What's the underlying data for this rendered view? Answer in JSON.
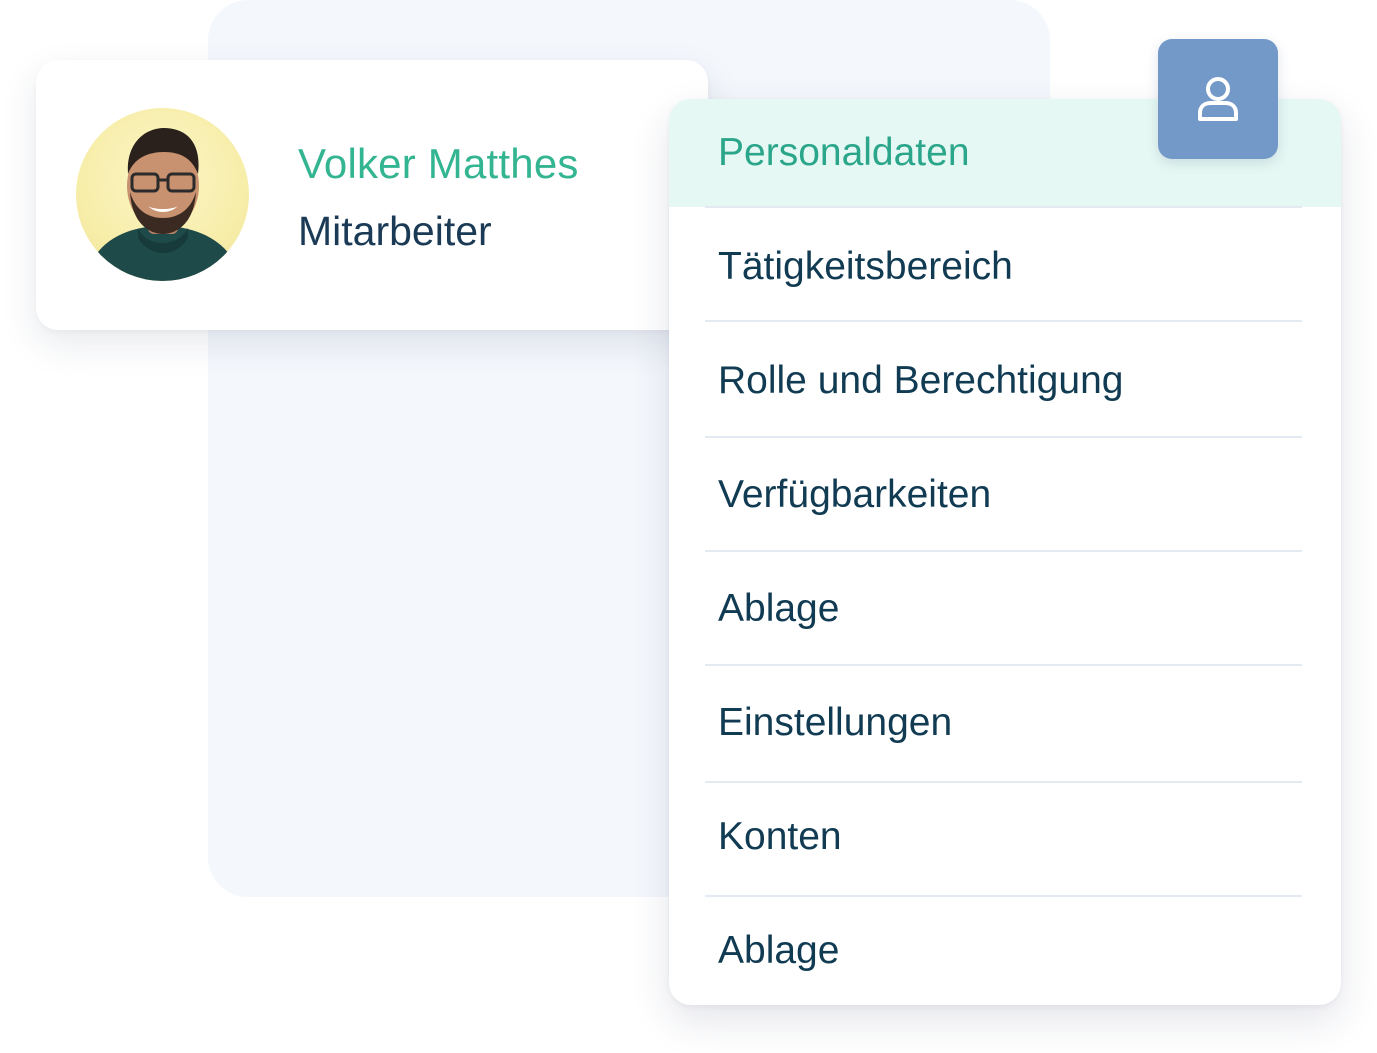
{
  "profile": {
    "name": "Volker Matthes",
    "role": "Mitarbeiter"
  },
  "user_button": {
    "icon": "user-icon"
  },
  "menu": {
    "items": [
      {
        "label": "Personaldaten",
        "active": true
      },
      {
        "label": "Tätigkeitsbereich",
        "active": false
      },
      {
        "label": "Rolle und Berechtigung",
        "active": false
      },
      {
        "label": "Verfügbarkeiten",
        "active": false
      },
      {
        "label": "Ablage",
        "active": false
      },
      {
        "label": "Einstellungen",
        "active": false
      },
      {
        "label": "Konten",
        "active": false
      },
      {
        "label": "Ablage",
        "active": false
      }
    ]
  },
  "colors": {
    "accent_green": "#33b592",
    "active_bg": "#e6f8f3",
    "text_dark": "#113b52",
    "user_button_bg": "#7399c9"
  }
}
